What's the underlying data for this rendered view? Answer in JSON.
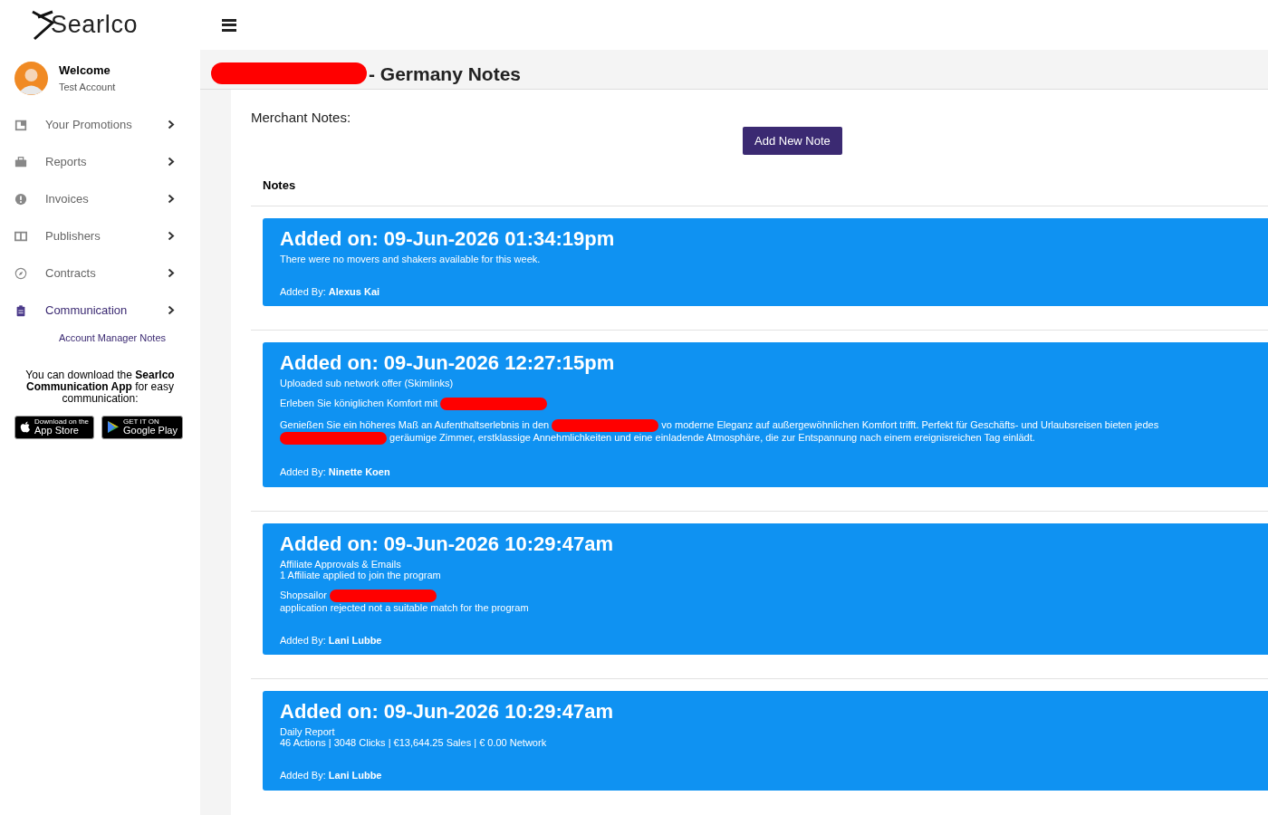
{
  "brand": {
    "logo_text": "Searlco"
  },
  "user": {
    "greeting": "Welcome",
    "account": "Test Account"
  },
  "sidebar": {
    "items": [
      {
        "label": "Your Promotions",
        "selected": false
      },
      {
        "label": "Reports",
        "selected": false
      },
      {
        "label": "Invoices",
        "selected": false
      },
      {
        "label": "Publishers",
        "selected": false
      },
      {
        "label": "Contracts",
        "selected": false
      },
      {
        "label": "Communication",
        "selected": true,
        "expanded": true,
        "children": [
          {
            "label": "Account Manager Notes"
          }
        ]
      }
    ]
  },
  "app_promo": {
    "text": "You can download the **Searlco Communication App** for easy communication:",
    "badges": [
      {
        "kind": "apple",
        "small": "Download on the",
        "big": "App Store"
      },
      {
        "kind": "google",
        "small": "GET IT ON",
        "big": "Google Play"
      }
    ]
  },
  "page": {
    "title": "- Germany Notes",
    "title_redacted": true,
    "merchant_label": "Merchant Notes:",
    "add_button": "Add New Note",
    "notes_heading": "Notes"
  },
  "notes": [
    {
      "added_on": "Added on: 09-Jun-2026 01:34:19pm",
      "blocks": [
        [
          [
            {
              "kind": "text",
              "text": "There were no movers and shakers available for this week."
            }
          ]
        ]
      ],
      "added_by_label": "Added By:",
      "added_by": "Alexus Kai"
    },
    {
      "added_on": "Added on: 09-Jun-2026 12:27:15pm",
      "blocks": [
        [
          [
            {
              "kind": "text",
              "text": "Uploaded sub network offer (Skimlinks)"
            }
          ]
        ],
        [
          [
            {
              "kind": "text",
              "text": "Erleben Sie königlichen Komfort mit"
            },
            {
              "kind": "redaction"
            }
          ]
        ],
        [
          [
            {
              "kind": "text",
              "text": "Genießen Sie ein höheres Maß an Aufenthaltserlebnis in den"
            },
            {
              "kind": "redaction"
            },
            {
              "kind": "text",
              "text": "vo moderne Eleganz auf außergewöhnlichen Komfort trifft. Perfekt für Geschäfts- und Urlaubsreisen bieten jedes"
            },
            {
              "kind": "redaction"
            },
            {
              "kind": "text",
              "text": "geräumige Zimmer, erstklassige Annehmlichkeiten und eine einladende Atmosphäre, die zur Entspannung nach einem ereignisreichen Tag einlädt."
            }
          ]
        ]
      ],
      "added_by_label": "Added By:",
      "added_by": "Ninette Koen"
    },
    {
      "added_on": "Added on: 09-Jun-2026 10:29:47am",
      "blocks": [
        [
          [
            {
              "kind": "text",
              "text": "Affiliate Approvals & Emails"
            }
          ],
          [
            {
              "kind": "text",
              "text": "1 Affiliate applied to join the program"
            }
          ]
        ],
        [
          [
            {
              "kind": "text",
              "text": "Shopsailor"
            },
            {
              "kind": "redaction"
            }
          ],
          [
            {
              "kind": "text",
              "text": "application rejected not a suitable match for the program"
            }
          ]
        ]
      ],
      "added_by_label": "Added By:",
      "added_by": "Lani Lubbe"
    },
    {
      "added_on": "Added on: 09-Jun-2026 10:29:47am",
      "blocks": [
        [
          [
            {
              "kind": "text",
              "text": "Daily Report"
            }
          ],
          [
            {
              "kind": "text",
              "text": "46 Actions | 3048 Clicks | €13,644.25 Sales | € 0.00 Network"
            }
          ]
        ]
      ],
      "added_by_label": "Added By:",
      "added_by": "Lani Lubbe"
    }
  ]
}
